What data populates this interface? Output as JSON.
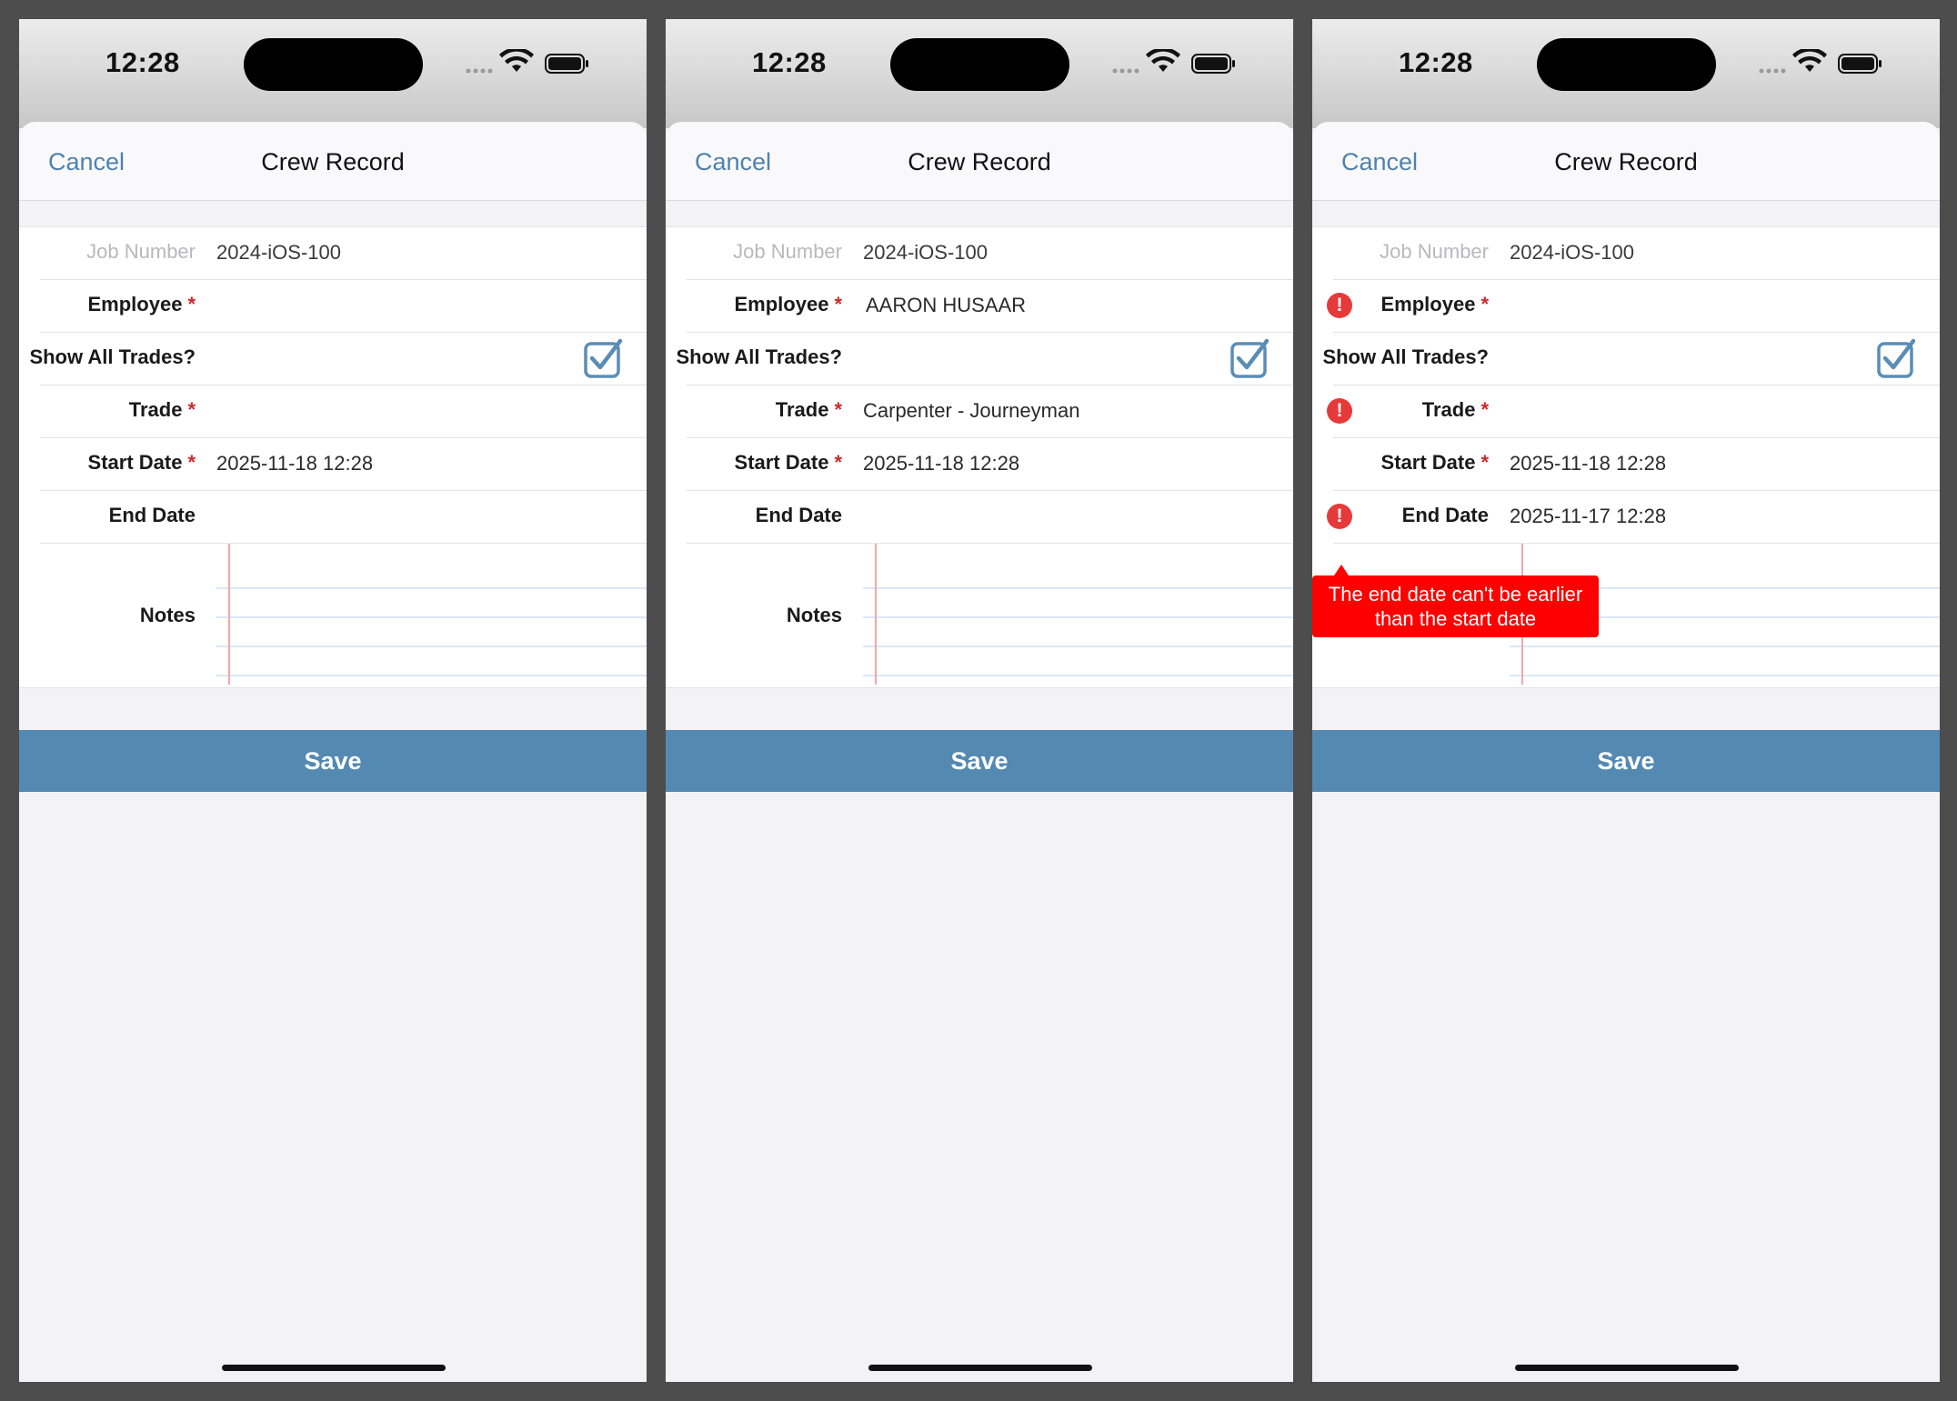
{
  "status": {
    "time": "12:28"
  },
  "nav": {
    "cancel_label": "Cancel",
    "title": "Crew Record"
  },
  "labels": {
    "job_number": "Job Number",
    "employee": "Employee",
    "show_all_trades": "Show All Trades?",
    "trade": "Trade",
    "start_date": "Start Date",
    "end_date": "End Date",
    "notes": "Notes",
    "required_mark": "*"
  },
  "save_label": "Save",
  "screens": [
    {
      "job_number": "2024-iOS-100",
      "employee": "",
      "show_all_trades": true,
      "trade": "",
      "start_date": "2025-11-18 12:28",
      "end_date": "",
      "notes": ""
    },
    {
      "job_number": "2024-iOS-100",
      "employee": "AARON HUSAAR",
      "show_all_trades": true,
      "trade": "Carpenter - Journeyman",
      "start_date": "2025-11-18 12:28",
      "end_date": "",
      "notes": ""
    },
    {
      "job_number": "2024-iOS-100",
      "employee": "",
      "show_all_trades": true,
      "trade": "",
      "start_date": "2025-11-18 12:28",
      "end_date": "2025-11-17 12:28",
      "notes": "",
      "error_icon": "exclamation-circle-icon",
      "error_message": "The end date can't be earlier than the start date"
    }
  ],
  "colors": {
    "accent": "#4f82ad",
    "save_bar": "#5489b1",
    "error": "#ff0000",
    "required": "#cc2a2a"
  }
}
